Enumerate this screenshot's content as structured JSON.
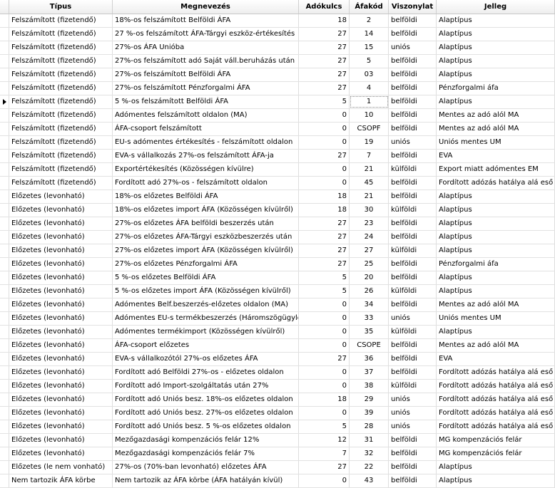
{
  "columns": [
    "",
    "Típus",
    "Megnevezés",
    "Adókulcs",
    "Áfakód",
    "Viszonylat",
    "Jelleg"
  ],
  "rows": [
    [
      "Felszámított (fizetendő)",
      "18%-os felszámított Belföldi ÁFA",
      "18",
      "2",
      "belföldi",
      "Alaptípus"
    ],
    [
      "Felszámított (fizetendő)",
      "27 %-os felszámított ÁFA-Tárgyi eszköz-értékesítés",
      "27",
      "14",
      "belföldi",
      "Alaptípus"
    ],
    [
      "Felszámított (fizetendő)",
      "27%-os ÁFA Unióba",
      "27",
      "15",
      "uniós",
      "Alaptípus"
    ],
    [
      "Felszámított (fizetendő)",
      "27%-os felszámított adó Saját váll.beruházás után",
      "27",
      "5",
      "belföldi",
      "Alaptípus"
    ],
    [
      "Felszámított (fizetendő)",
      "27%-os felszámított Belföldi ÁFA",
      "27",
      "03",
      "belföldi",
      "Alaptípus"
    ],
    [
      "Felszámított (fizetendő)",
      "27%-os felszámított Pénzforgalmi ÁFA",
      "27",
      "4",
      "belföldi",
      "Pénzforgalmi áfa"
    ],
    [
      "Felszámított (fizetendő)",
      "5 %-os felszámított Belföldi ÁFA",
      "5",
      "1",
      "belföldi",
      "Alaptípus"
    ],
    [
      "Felszámított (fizetendő)",
      "Adómentes felszámított oldalon (MA)",
      "0",
      "10",
      "belföldi",
      "Mentes az adó alól  MA"
    ],
    [
      "Felszámított (fizetendő)",
      "ÁFA-csoport felszámított",
      "0",
      "CSOPF",
      "belföldi",
      "Mentes az adó alól  MA"
    ],
    [
      "Felszámított (fizetendő)",
      "EU-s adómentes értékesítés - felszámított oldalon",
      "0",
      "19",
      "uniós",
      "Uniós mentes UM"
    ],
    [
      "Felszámított (fizetendő)",
      "EVA-s vállalkozás 27%-os felszámított ÁFA-ja",
      "27",
      "7",
      "belföldi",
      "EVA"
    ],
    [
      "Felszámított (fizetendő)",
      "Exportértékesítés (Közösségen kívülre)",
      "0",
      "21",
      "külföldi",
      "Export miatt adómentes EM"
    ],
    [
      "Felszámított (fizetendő)",
      "Fordított adó 27%-os - felszámított oldalon",
      "0",
      "45",
      "belföldi",
      "Fordított adózás hatálya alá eső"
    ],
    [
      "Előzetes (levonható)",
      "18%-os előzetes Belföldi ÁFA",
      "18",
      "21",
      "belföldi",
      "Alaptípus"
    ],
    [
      "Előzetes (levonható)",
      "18%-os előzetes import ÁFA (Közösségen kívülről)",
      "18",
      "30",
      "külföldi",
      "Alaptípus"
    ],
    [
      "Előzetes (levonható)",
      "27%-os előzetes ÁFA belföldi beszerzés után",
      "27",
      "23",
      "belföldi",
      "Alaptípus"
    ],
    [
      "Előzetes (levonható)",
      "27%-os előzetes ÁFA-Tárgyi eszközbeszerzés után",
      "27",
      "24",
      "belföldi",
      "Alaptípus"
    ],
    [
      "Előzetes (levonható)",
      "27%-os előzetes import ÁFA (Közösségen kívülről)",
      "27",
      "27",
      "külföldi",
      "Alaptípus"
    ],
    [
      "Előzetes (levonható)",
      "27%-os előzetes Pénzforgalmi ÁFA",
      "27",
      "25",
      "belföldi",
      "Pénzforgalmi áfa"
    ],
    [
      "Előzetes (levonható)",
      "5 %-os előzetes Belföldi ÁFA",
      "5",
      "20",
      "belföldi",
      "Alaptípus"
    ],
    [
      "Előzetes (levonható)",
      "5 %-os előzetes import ÁFA (Közösségen kívülről)",
      "5",
      "26",
      "külföldi",
      "Alaptípus"
    ],
    [
      "Előzetes (levonható)",
      "Adómentes Belf.beszerzés-előzetes oldalon (MA)",
      "0",
      "34",
      "belföldi",
      "Mentes az adó alól  MA"
    ],
    [
      "Előzetes (levonható)",
      "Adómentes EU-s termékbeszerzés (Háromszögügylet!)",
      "0",
      "33",
      "uniós",
      "Uniós mentes UM"
    ],
    [
      "Előzetes (levonható)",
      "Adómentes termékimport (Közösségen kívülről)",
      "0",
      "35",
      "külföldi",
      "Alaptípus"
    ],
    [
      "Előzetes (levonható)",
      "ÁFA-csoport előzetes",
      "0",
      "CSOPE",
      "belföldi",
      "Mentes az adó alól  MA"
    ],
    [
      "Előzetes (levonható)",
      "EVA-s vállalkozótól 27%-os előzetes ÁFA",
      "27",
      "36",
      "belföldi",
      "EVA"
    ],
    [
      "Előzetes (levonható)",
      "Fordított adó Belföldi 27%-os - előzetes oldalon",
      "0",
      "37",
      "belföldi",
      "Fordított adózás hatálya alá eső"
    ],
    [
      "Előzetes (levonható)",
      "Fordított adó Import-szolgáltatás után 27%",
      "0",
      "38",
      "külföldi",
      "Fordított adózás hatálya alá eső"
    ],
    [
      "Előzetes (levonható)",
      "Fordított adó Uniós besz. 18%-os előzetes oldalon",
      "18",
      "29",
      "uniós",
      "Fordított adózás hatálya alá eső"
    ],
    [
      "Előzetes (levonható)",
      "Fordított adó Uniós besz. 27%-os előzetes oldalon",
      "0",
      "39",
      "uniós",
      "Fordított adózás hatálya alá eső"
    ],
    [
      "Előzetes (levonható)",
      "Fordított adó Uniós besz. 5 %-os előzetes oldalon",
      "5",
      "28",
      "uniós",
      "Fordított adózás hatálya alá eső"
    ],
    [
      "Előzetes (levonható)",
      "Mezőgazdasági kompenzációs felár 12%",
      "12",
      "31",
      "belföldi",
      "MG kompenzációs felár"
    ],
    [
      "Előzetes (levonható)",
      "Mezőgazdasági kompenzációs felár 7%",
      "7",
      "32",
      "belföldi",
      "MG kompenzációs felár"
    ],
    [
      "Előzetes (le nem vonható)",
      "27%-os (70%-ban levonható) előzetes ÁFA",
      "27",
      "22",
      "belföldi",
      "Alaptípus"
    ],
    [
      "Nem tartozik ÁFA körbe",
      "Nem tartozik az ÁFA körbe (ÁFA hatályán kívül)",
      "0",
      "43",
      "belföldi",
      "Alaptípus"
    ]
  ],
  "current_row": 6
}
